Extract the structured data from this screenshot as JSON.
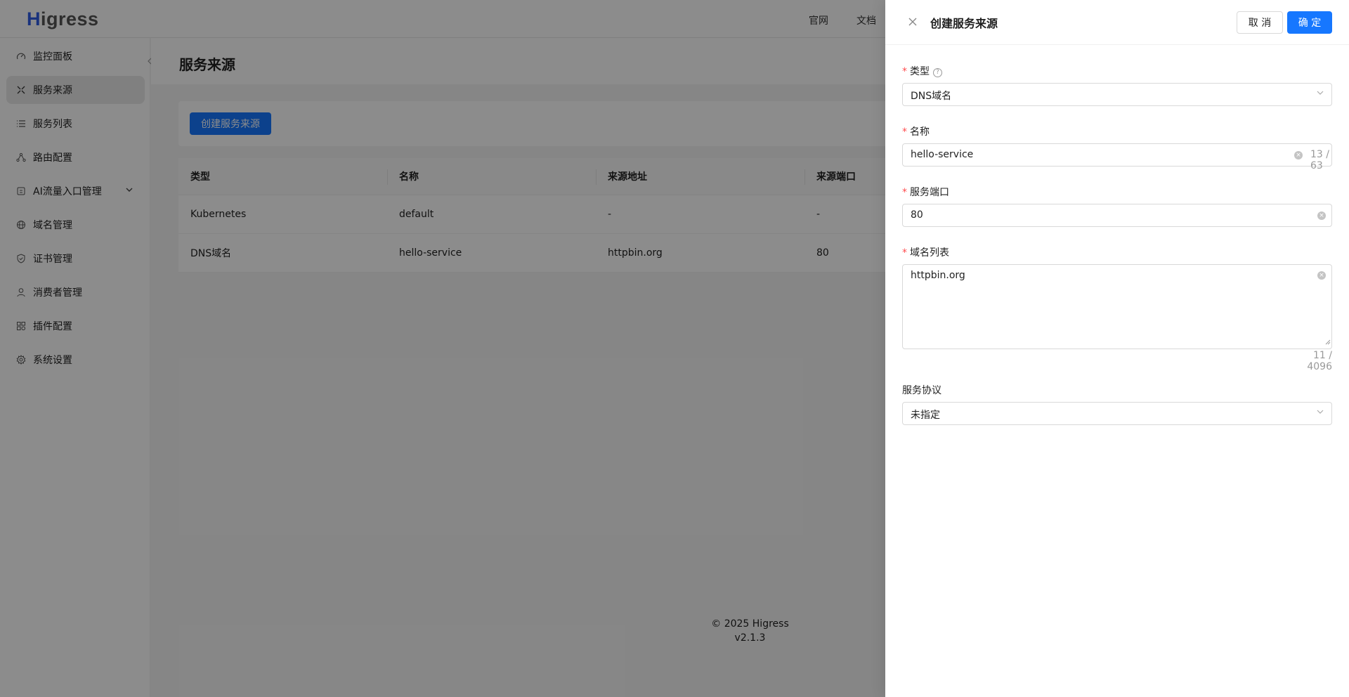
{
  "app": {
    "logo_h": "H",
    "logo_rest": "igress"
  },
  "topnav": {
    "official": "官网",
    "docs": "文档"
  },
  "sidebar": {
    "items": [
      {
        "label": "监控面板",
        "icon": "dashboard-icon"
      },
      {
        "label": "服务来源",
        "icon": "service-source-icon",
        "active": true
      },
      {
        "label": "服务列表",
        "icon": "list-icon"
      },
      {
        "label": "路由配置",
        "icon": "route-icon"
      },
      {
        "label": "AI流量入口管理",
        "icon": "ai-icon",
        "expandable": true
      },
      {
        "label": "域名管理",
        "icon": "globe-icon"
      },
      {
        "label": "证书管理",
        "icon": "shield-icon"
      },
      {
        "label": "消费者管理",
        "icon": "user-icon"
      },
      {
        "label": "插件配置",
        "icon": "plugin-icon"
      },
      {
        "label": "系统设置",
        "icon": "gear-icon"
      }
    ]
  },
  "main": {
    "title": "服务来源",
    "create_button": "创建服务来源",
    "table": {
      "columns": [
        "类型",
        "名称",
        "来源地址",
        "来源端口"
      ],
      "rows": [
        [
          "Kubernetes",
          "default",
          "-",
          "-"
        ],
        [
          "DNS域名",
          "hello-service",
          "httpbin.org",
          "80"
        ]
      ]
    }
  },
  "footer": {
    "copyright": "© 2025 Higress",
    "version": "v2.1.3"
  },
  "drawer": {
    "title": "创建服务来源",
    "cancel": "取 消",
    "ok": "确 定",
    "fields": {
      "type": {
        "label": "类型",
        "value": "DNS域名"
      },
      "name": {
        "label": "名称",
        "value": "hello-service",
        "counter": "13 / 63"
      },
      "port": {
        "label": "服务端口",
        "value": "80"
      },
      "domains": {
        "label": "域名列表",
        "value": "httpbin.org",
        "counter": "11 / 4096"
      },
      "protocol": {
        "label": "服务协议",
        "value": "未指定"
      }
    }
  },
  "colors": {
    "primary": "#1677ff",
    "required": "#ff4d4f",
    "logo_blue": "#2f5be3"
  }
}
